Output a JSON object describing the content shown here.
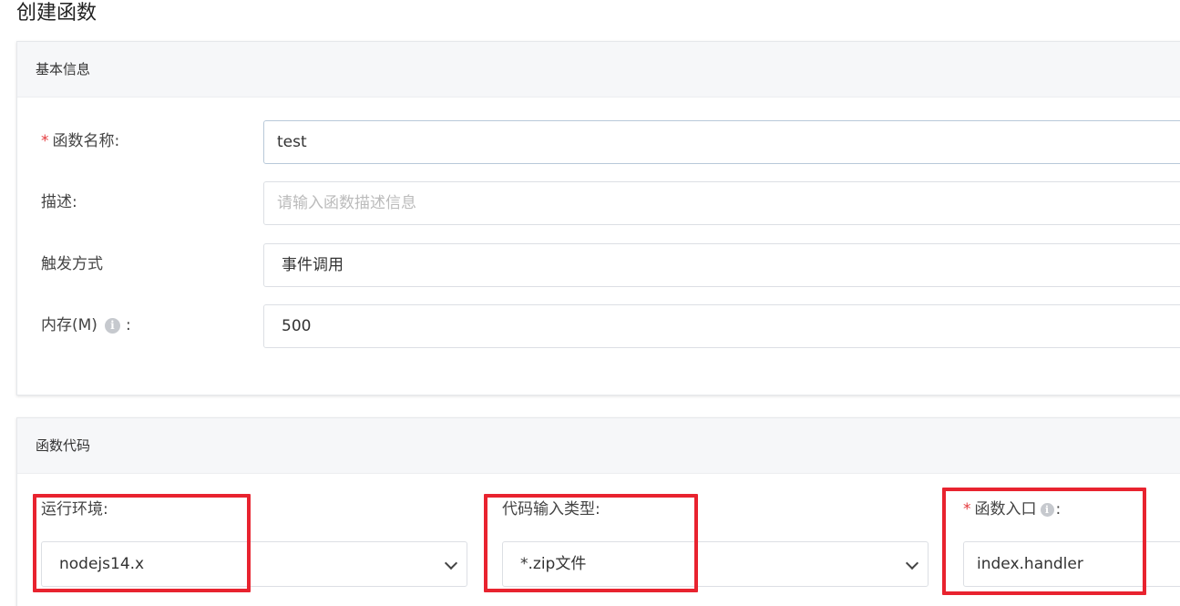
{
  "page": {
    "title": "创建函数"
  },
  "basic_info": {
    "header": "基本信息",
    "function_name": {
      "required_mark": "*",
      "label": "函数名称:",
      "value": "test"
    },
    "description": {
      "label": "描述:",
      "placeholder": "请输入函数描述信息"
    },
    "trigger": {
      "label": "触发方式",
      "value": "事件调用"
    },
    "memory": {
      "label": "内存(M)",
      "info_icon": "info-icon",
      "label_suffix": ":",
      "value": "500"
    }
  },
  "function_code": {
    "header": "函数代码",
    "runtime": {
      "label": "运行环境:",
      "value": "nodejs14.x"
    },
    "code_type": {
      "label": "代码输入类型:",
      "value": "*.zip文件"
    },
    "entry": {
      "required_mark": "*",
      "label": "函数入口",
      "info_icon": "info-icon",
      "label_suffix": ":",
      "value": "index.handler"
    }
  },
  "colors": {
    "highlight": "#e8232f",
    "required": "#e4393c",
    "header_bg": "#f6f7f9"
  }
}
